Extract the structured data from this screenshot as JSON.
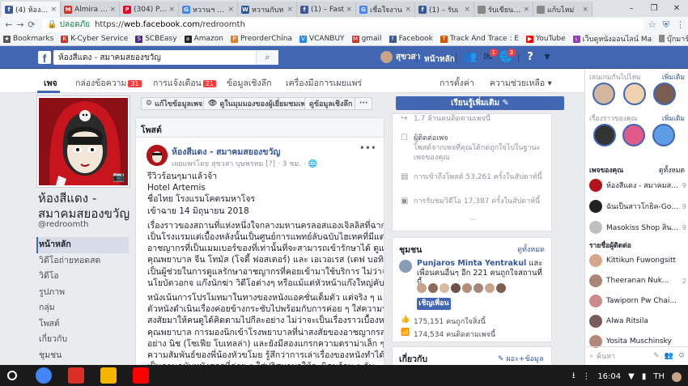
{
  "browser": {
    "tabs": [
      {
        "title": "(4) ห้องสีแ",
        "active": true,
        "color": "#3b5998",
        "glyph": "f"
      },
      {
        "title": "Almira Ay",
        "color": "#d93025",
        "glyph": "M"
      },
      {
        "title": "(304) Pint",
        "color": "#e60023",
        "glyph": "P"
      },
      {
        "title": "หวานฯ free",
        "color": "#4285f4",
        "glyph": "G"
      },
      {
        "title": "หวานกับห",
        "color": "#2b579a",
        "glyph": "W"
      },
      {
        "title": "(1) – Fast",
        "color": "#3b5998",
        "glyph": "f"
      },
      {
        "title": "เชื่อใจงาน",
        "color": "#4285f4",
        "glyph": "G"
      },
      {
        "title": "(1) – รับเ",
        "color": "#3b5998",
        "glyph": "f"
      },
      {
        "title": "รับเขียนคอ",
        "color": "#888888",
        "glyph": ""
      },
      {
        "title": "แก้บไหม่",
        "color": "#888888",
        "glyph": ""
      }
    ],
    "window_controls": [
      "–",
      "❐",
      "✕"
    ],
    "address": {
      "secure_label": "ปลอดภัย",
      "url_prefix": "https://",
      "url_host": "web.facebook.com",
      "url_path": "/redroomth"
    },
    "bookmarks": [
      {
        "label": "Bookmarks",
        "icon": "star-icon",
        "color": "#555555",
        "glyph": "★"
      },
      {
        "label": "K-Cyber Service",
        "color": "#d93025",
        "glyph": "K"
      },
      {
        "label": "SCBEasy",
        "color": "#4e2a84",
        "glyph": "S"
      },
      {
        "label": "Amazon",
        "color": "#222222",
        "glyph": "a"
      },
      {
        "label": "PreorderChina",
        "color": "#e67e22",
        "glyph": "P"
      },
      {
        "label": "VCANBUY",
        "color": "#2e86de",
        "glyph": "V"
      },
      {
        "label": "gmail",
        "color": "#d93025",
        "glyph": "M"
      },
      {
        "label": "Facebook",
        "color": "#3b5998",
        "glyph": "f"
      },
      {
        "label": "Track And Trace : E",
        "color": "#d35400",
        "glyph": "T"
      },
      {
        "label": "YouTube",
        "color": "#ff0000",
        "glyph": "▶"
      },
      {
        "label": "เว็บดูหนังออนไลน์ Ma",
        "color": "#8e44ad",
        "glyph": "เ"
      }
    ],
    "bookmarks_other": "บุ๊กมาร์กอื่นๆ"
  },
  "fb_header": {
    "search_value": "ห้องสีแดง - สมาคมสยองขวัญ",
    "user_name": "สุขวสา",
    "home_label": "หน้าหลัก",
    "friend_badge": "1",
    "notif_badge": "3"
  },
  "page_nav": {
    "items": [
      "เพจ",
      "กล่องข้อความ",
      "การแจ้งเตือน",
      "ข้อมูลเชิงลึก",
      "เครื่องมือการเผยแพร่"
    ],
    "inbox_count": "31",
    "notif_count": "21",
    "settings": "การตั้งค่า",
    "help": "ความช่วยเหลือ ▾"
  },
  "left": {
    "page_name": "ห้องสีแดง - สมาคมสยองขวัญ",
    "handle": "@redroomth",
    "menu": [
      "หน้าหลัก",
      "วิดีโอถ่ายทอดสด",
      "วิดีโอ",
      "รูปภาพ",
      "กลุ่ม",
      "โพสต์",
      "เกี่ยวกับ",
      "ชุมชน"
    ]
  },
  "actions": {
    "edit_info": "แก้ไขข้อมูลเพจ",
    "view_as": "ดูในมุมมองของผู้เยี่ยมชมเพจ",
    "insights": "ดูข้อมูลเชิงลึก",
    "more": "···",
    "learn_more": "เรียนรู้เพิ่มเติม"
  },
  "posts": {
    "header": "โพสต์",
    "author": "ห้องสีแดง - สมาคมสยองขวัญ",
    "meta": "เผยแพร่โดย สุขวสา บุษพรหม [?] · 3 ชม. · 🌐",
    "lines_top": [
      "รีวิวร้อนๆมาแล้วจ้า",
      "Hotel Artemis",
      "ชื่อไทย โรงแรมโคตรมหาโจร",
      "เข้าฉาย 14 มิถุนายน 2018"
    ],
    "para1": [
      "เรื่องราวของสถานที่แห่งหนึ่งใจกลางมหานครลอสแองเจิลลิสที่ฉากหน้า",
      "เป็นโรงแรมแต่เบื้องหลังนั้นเป็นศูนย์การแพทย์ลับฉบับไฮเทคที่มีแต่",
      "อาชญากรที่เป็นเมมเบอร์ของที่เท่านั้นที่จะสามารถเข้ารักษาได้ ดูแลโดย",
      "คุณพยาบาล จีน โทมัส (โจดี้ ฟอสเตอร์) และ เอเวอเรส (เดฟ บอทิสต้า)",
      "เป็นผู้ช่วยในการดูแลรักษาอาชญากรที่คอยเข้ามาใช้บริการ ไม่ว่าจะเป็น",
      "นโยบัตวอกจ แก๊งนักฆ่า วิดีโอต่างๆ หรือแม้แต่หัวหน้าแก๊งใหญ่คับประเทศ"
    ],
    "para2": [
      "หนังเน้นการโปรโมทมาในทางของหนังแอคชั่นเต็มตัว แต่จริง ๆ แล้วนั้น",
      "ตัวหนังดำเนินเรื่องค่อยข้างกระชับไปพร้อมกับการค่อย ๆ ใส่ความน่า",
      "สงสัยมาให้คนดูได้คิดตามไปกีละอย่าง ไม่ว่าจะเป็นเรื่องราวเบื้องหลังของ",
      "คุณพยาบาล การมองนิกเข้าโรงพยาบาลที่น่าสงสัยของอาชญากรสาว",
      "อย่าง นิช (โซเฟีย โบเทลล่า) และยังมีสองแกรกความดราม่าเล็ก ๆ ระหว่าง",
      "ความสัมพันธ์ของพี่น้องหัวขโมย รู้สึกว่าการเล่าเรื่องของหนังทำได้ดีแต่ก็",
      "เป็นตามฉบับหนังสูตรที่ค่อย ๆ ใส่ปริศนามาให้ละนิดพร้อม ๆ กับ"
    ]
  },
  "info": {
    "row0": "1.7 ล้านคนติดตามเพจนี้",
    "row1": "ผู้ติดต่อเพจ",
    "row1b": "โพสต์จากเพจที่คุณได้กดถูกใจไปในฐานะเพจของคุณ",
    "row2": "การเข้าถึงโพสต์ 53,261 ครั้งในสัปดาห์นี้",
    "row3": "การรับชมวิดีโอ 17,387 ครั้งในสัปดาห์นี้",
    "more": "···"
  },
  "partners": {
    "title": "ชุมชน",
    "link": "ดูทั้งหมด",
    "text_name": "Punjaros Minta Yentrakul",
    "text_rest": "และเพื่อนคนอื่นๆ อีก 221 คนถูกใจสถานที่นี้",
    "invite": "เชิญเพื่อน",
    "likes": "175,151 คนถูกใจสิ่งนี้",
    "follows": "174,534 คนติดตามเพจนี้"
  },
  "about": {
    "title": "เกี่ยวกับ",
    "edit": "✎ ผอะ+ข้อมูล"
  },
  "sidebar": {
    "stories_title": "เล่นเกมกันไปไหม",
    "stories_more": "เพิ่มเติม",
    "stories2_title": "เรื่องราวของคุณ",
    "stories2_more": "เพิ่มเติม",
    "pages_title": "เพจของคุณ",
    "pages_more": "ดูทั้งหมด",
    "pages": [
      {
        "name": "ห้องสีแดง - สมาคมส...",
        "count": "9",
        "color": "#b3121a"
      },
      {
        "name": "ฉันเป็นสาวโกธิค-Got...",
        "count": "9",
        "color": "#222222"
      },
      {
        "name": "Masokiss Shop สิน...",
        "count": "9",
        "color": "#c0c0c0"
      }
    ],
    "contacts_title": "รายชื่อผู้ติดต่อ",
    "contacts": [
      {
        "name": "Kittikun Fuwongsitt",
        "count": "",
        "color": "#d6a68c"
      },
      {
        "name": "Theeranan Nuk...",
        "count": "2",
        "color": "#a98676"
      },
      {
        "name": "Tawiporn Pw Chai...",
        "count": "",
        "color": "#c98b8b"
      },
      {
        "name": "Alwa Ritsila",
        "count": "",
        "color": "#7a5a5a"
      },
      {
        "name": "Yosita Muschinsky",
        "count": "",
        "color": "#b0897a"
      }
    ],
    "search_placeholder": "ค้นหา"
  },
  "taskbar": {
    "time": "16:04",
    "lang": "TH",
    "apps": [
      {
        "name": "chrome",
        "color": "#4285f4"
      },
      {
        "name": "gmail",
        "color": "#d93025"
      },
      {
        "name": "drive",
        "color": "#f4b400"
      },
      {
        "name": "youtube",
        "color": "#ff0000"
      }
    ]
  }
}
